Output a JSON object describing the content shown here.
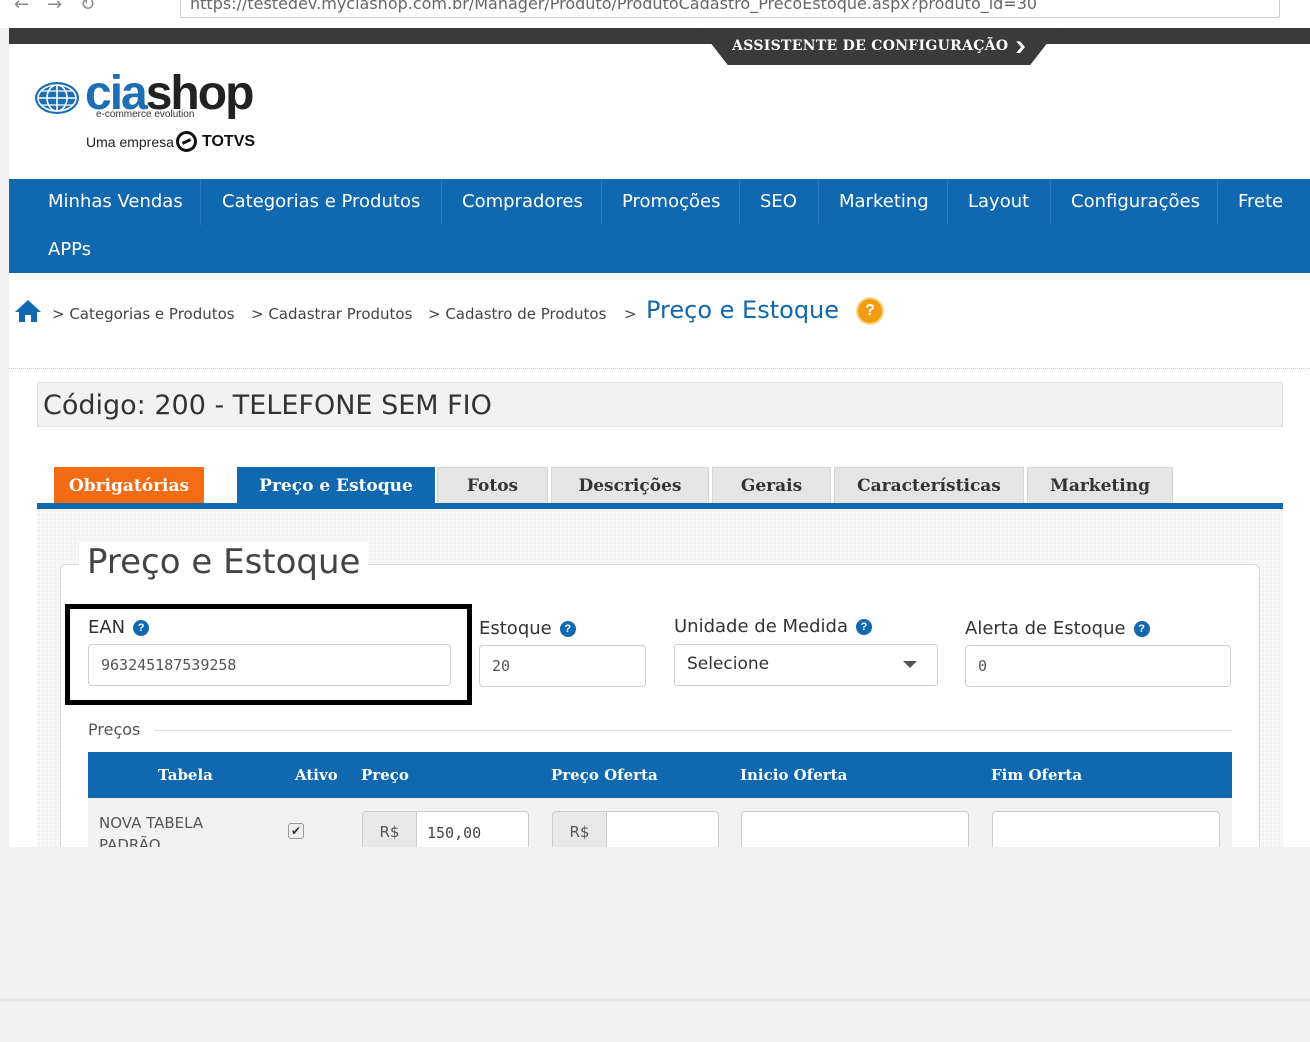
{
  "browser": {
    "url": "https://testedev.myciashop.com.br/Manager/Produto/ProdutoCadastro_PrecoEstoque.aspx?produto_id=30"
  },
  "wizard": {
    "label": "ASSISTENTE DE CONFIGURAÇÃO"
  },
  "logo": {
    "brand_cia": "cia",
    "brand_shop": "shop",
    "tagline": "e-commerce evolution",
    "empresa": "Uma empresa",
    "totvs": "TOTVS"
  },
  "nav": {
    "items": [
      {
        "label": "Minhas Vendas"
      },
      {
        "label": "Categorias e Produtos"
      },
      {
        "label": "Compradores"
      },
      {
        "label": "Promoções"
      },
      {
        "label": "SEO"
      },
      {
        "label": "Marketing"
      },
      {
        "label": "Layout"
      },
      {
        "label": "Configurações"
      },
      {
        "label": "Frete"
      },
      {
        "label": "APPs"
      }
    ]
  },
  "breadcrumb": {
    "items": [
      {
        "label": "> Categorias e Produtos"
      },
      {
        "label": "> Cadastrar Produtos"
      },
      {
        "label": "> Cadastro de Produtos"
      },
      {
        "label": ">"
      }
    ],
    "current": "Preço e Estoque",
    "help": "?"
  },
  "product": {
    "code_line": "Código: 200 - TELEFONE SEM FIO"
  },
  "tabs": [
    {
      "label": "Obrigatórias",
      "state": "required"
    },
    {
      "label": "Preço e Estoque",
      "state": "active"
    },
    {
      "label": "Fotos"
    },
    {
      "label": "Descrições"
    },
    {
      "label": "Gerais"
    },
    {
      "label": "Características"
    },
    {
      "label": "Marketing"
    }
  ],
  "form": {
    "legend": "Preço e Estoque",
    "ean": {
      "label": "EAN",
      "value": "963245187539258"
    },
    "estoque": {
      "label": "Estoque",
      "value": "20"
    },
    "unidade": {
      "label": "Unidade de Medida",
      "value": "Selecione"
    },
    "alerta": {
      "label": "Alerta de Estoque",
      "value": "0"
    },
    "help_glyph": "?"
  },
  "prices": {
    "section_label": "Preços",
    "headers": [
      "Tabela",
      "Ativo",
      "Preço",
      "Preço Oferta",
      "Inicio Oferta",
      "Fim Oferta"
    ],
    "rows": [
      {
        "tabela": "NOVA TABELA PADRÃO",
        "ativo": true,
        "currency": "R$",
        "preco": "150,00",
        "preco_oferta": "",
        "inicio_oferta": "",
        "fim_oferta": ""
      }
    ]
  },
  "colors": {
    "primary": "#1068b0",
    "required_tab": "#f36b12",
    "help_orange": "#f39c12",
    "topbar": "#3a3a3a"
  }
}
